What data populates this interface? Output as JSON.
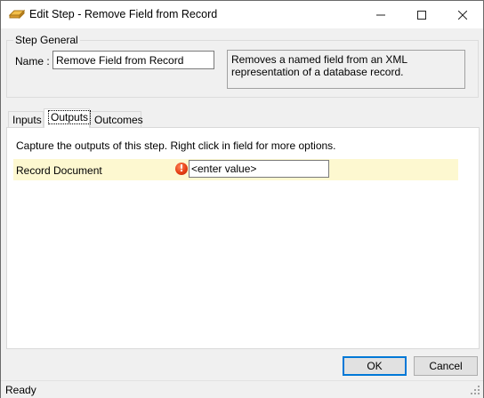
{
  "window": {
    "title": "Edit Step - Remove Field from Record",
    "app_icon": "step-icon",
    "controls": [
      "minimize-icon",
      "maximize-icon",
      "close-icon"
    ]
  },
  "step_general": {
    "legend": "Step General",
    "name_label": "Name :",
    "name_value": "Remove Field from Record",
    "description": "Removes a named field from an XML representation of a database record."
  },
  "tabs": {
    "items": [
      {
        "label": "Inputs"
      },
      {
        "label": "Outputs",
        "selected": true
      },
      {
        "label": "Outcomes"
      }
    ]
  },
  "outputs_panel": {
    "description": "Capture the outputs of this step.  Right click in field for more options.",
    "rows": [
      {
        "label": "Record Document",
        "value": "<enter value>",
        "status_icon": "error-icon",
        "status_mark": "!"
      }
    ]
  },
  "buttons": {
    "ok": "OK",
    "cancel": "Cancel"
  },
  "status": {
    "text": "Ready"
  },
  "colors": {
    "row_highlight": "#fdf8d0",
    "accent": "#0078d7",
    "error": "#e63e14"
  }
}
